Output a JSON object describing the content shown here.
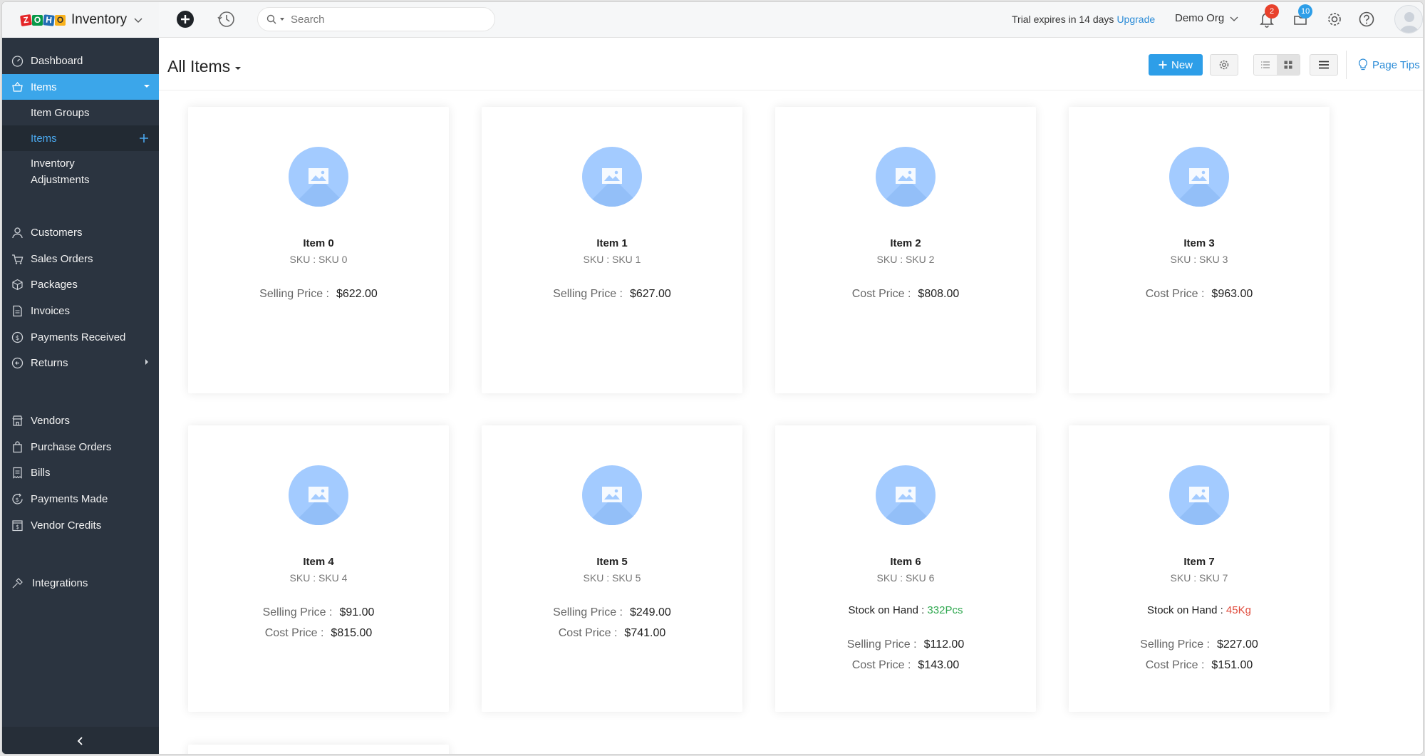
{
  "app": {
    "name": "Inventory"
  },
  "search": {
    "placeholder": "Search"
  },
  "topbar": {
    "trial_text": "Trial expires in 14 days",
    "upgrade": "Upgrade",
    "org": "Demo Org",
    "notifications_count": "2",
    "updates_count": "10"
  },
  "sidebar": {
    "dashboard": "Dashboard",
    "items": "Items",
    "item_groups": "Item Groups",
    "items_sub": "Items",
    "inventory_adjustments_1": "Inventory",
    "inventory_adjustments_2": "Adjustments",
    "customers": "Customers",
    "sales_orders": "Sales Orders",
    "packages": "Packages",
    "invoices": "Invoices",
    "payments_received": "Payments Received",
    "returns": "Returns",
    "vendors": "Vendors",
    "purchase_orders": "Purchase Orders",
    "bills": "Bills",
    "payments_made": "Payments Made",
    "vendor_credits": "Vendor Credits",
    "integrations": "Integrations"
  },
  "page": {
    "title": "All Items",
    "new_label": "New",
    "page_tips": "Page Tips"
  },
  "labels": {
    "selling_price": "Selling Price :",
    "cost_price": "Cost Price :",
    "stock_on_hand": "Stock on Hand :"
  },
  "items": [
    {
      "name": "Item 0",
      "sku": "SKU : SKU 0",
      "selling": "$622.00"
    },
    {
      "name": "Item 1",
      "sku": "SKU : SKU 1",
      "selling": "$627.00"
    },
    {
      "name": "Item 2",
      "sku": "SKU : SKU 2",
      "cost": "$808.00"
    },
    {
      "name": "Item 3",
      "sku": "SKU : SKU 3",
      "cost": "$963.00"
    },
    {
      "name": "Item 4",
      "sku": "SKU : SKU 4",
      "selling": "$91.00",
      "cost": "$815.00"
    },
    {
      "name": "Item 5",
      "sku": "SKU : SKU 5",
      "selling": "$249.00",
      "cost": "$741.00"
    },
    {
      "name": "Item 6",
      "sku": "SKU : SKU 6",
      "stock": "332Pcs",
      "selling": "$112.00",
      "cost": "$143.00"
    },
    {
      "name": "Item 7",
      "sku": "SKU : SKU 7",
      "stock": "45Kg",
      "selling": "$227.00",
      "cost": "$151.00"
    }
  ],
  "colors": {
    "sidebar_bg": "#2b3440",
    "accent_blue": "#3ba6ea",
    "stock_green": "#2fa84f",
    "stock_red": "#e04b3c",
    "notification_red": "#e8412c",
    "updates_blue": "#2d9ee8"
  }
}
